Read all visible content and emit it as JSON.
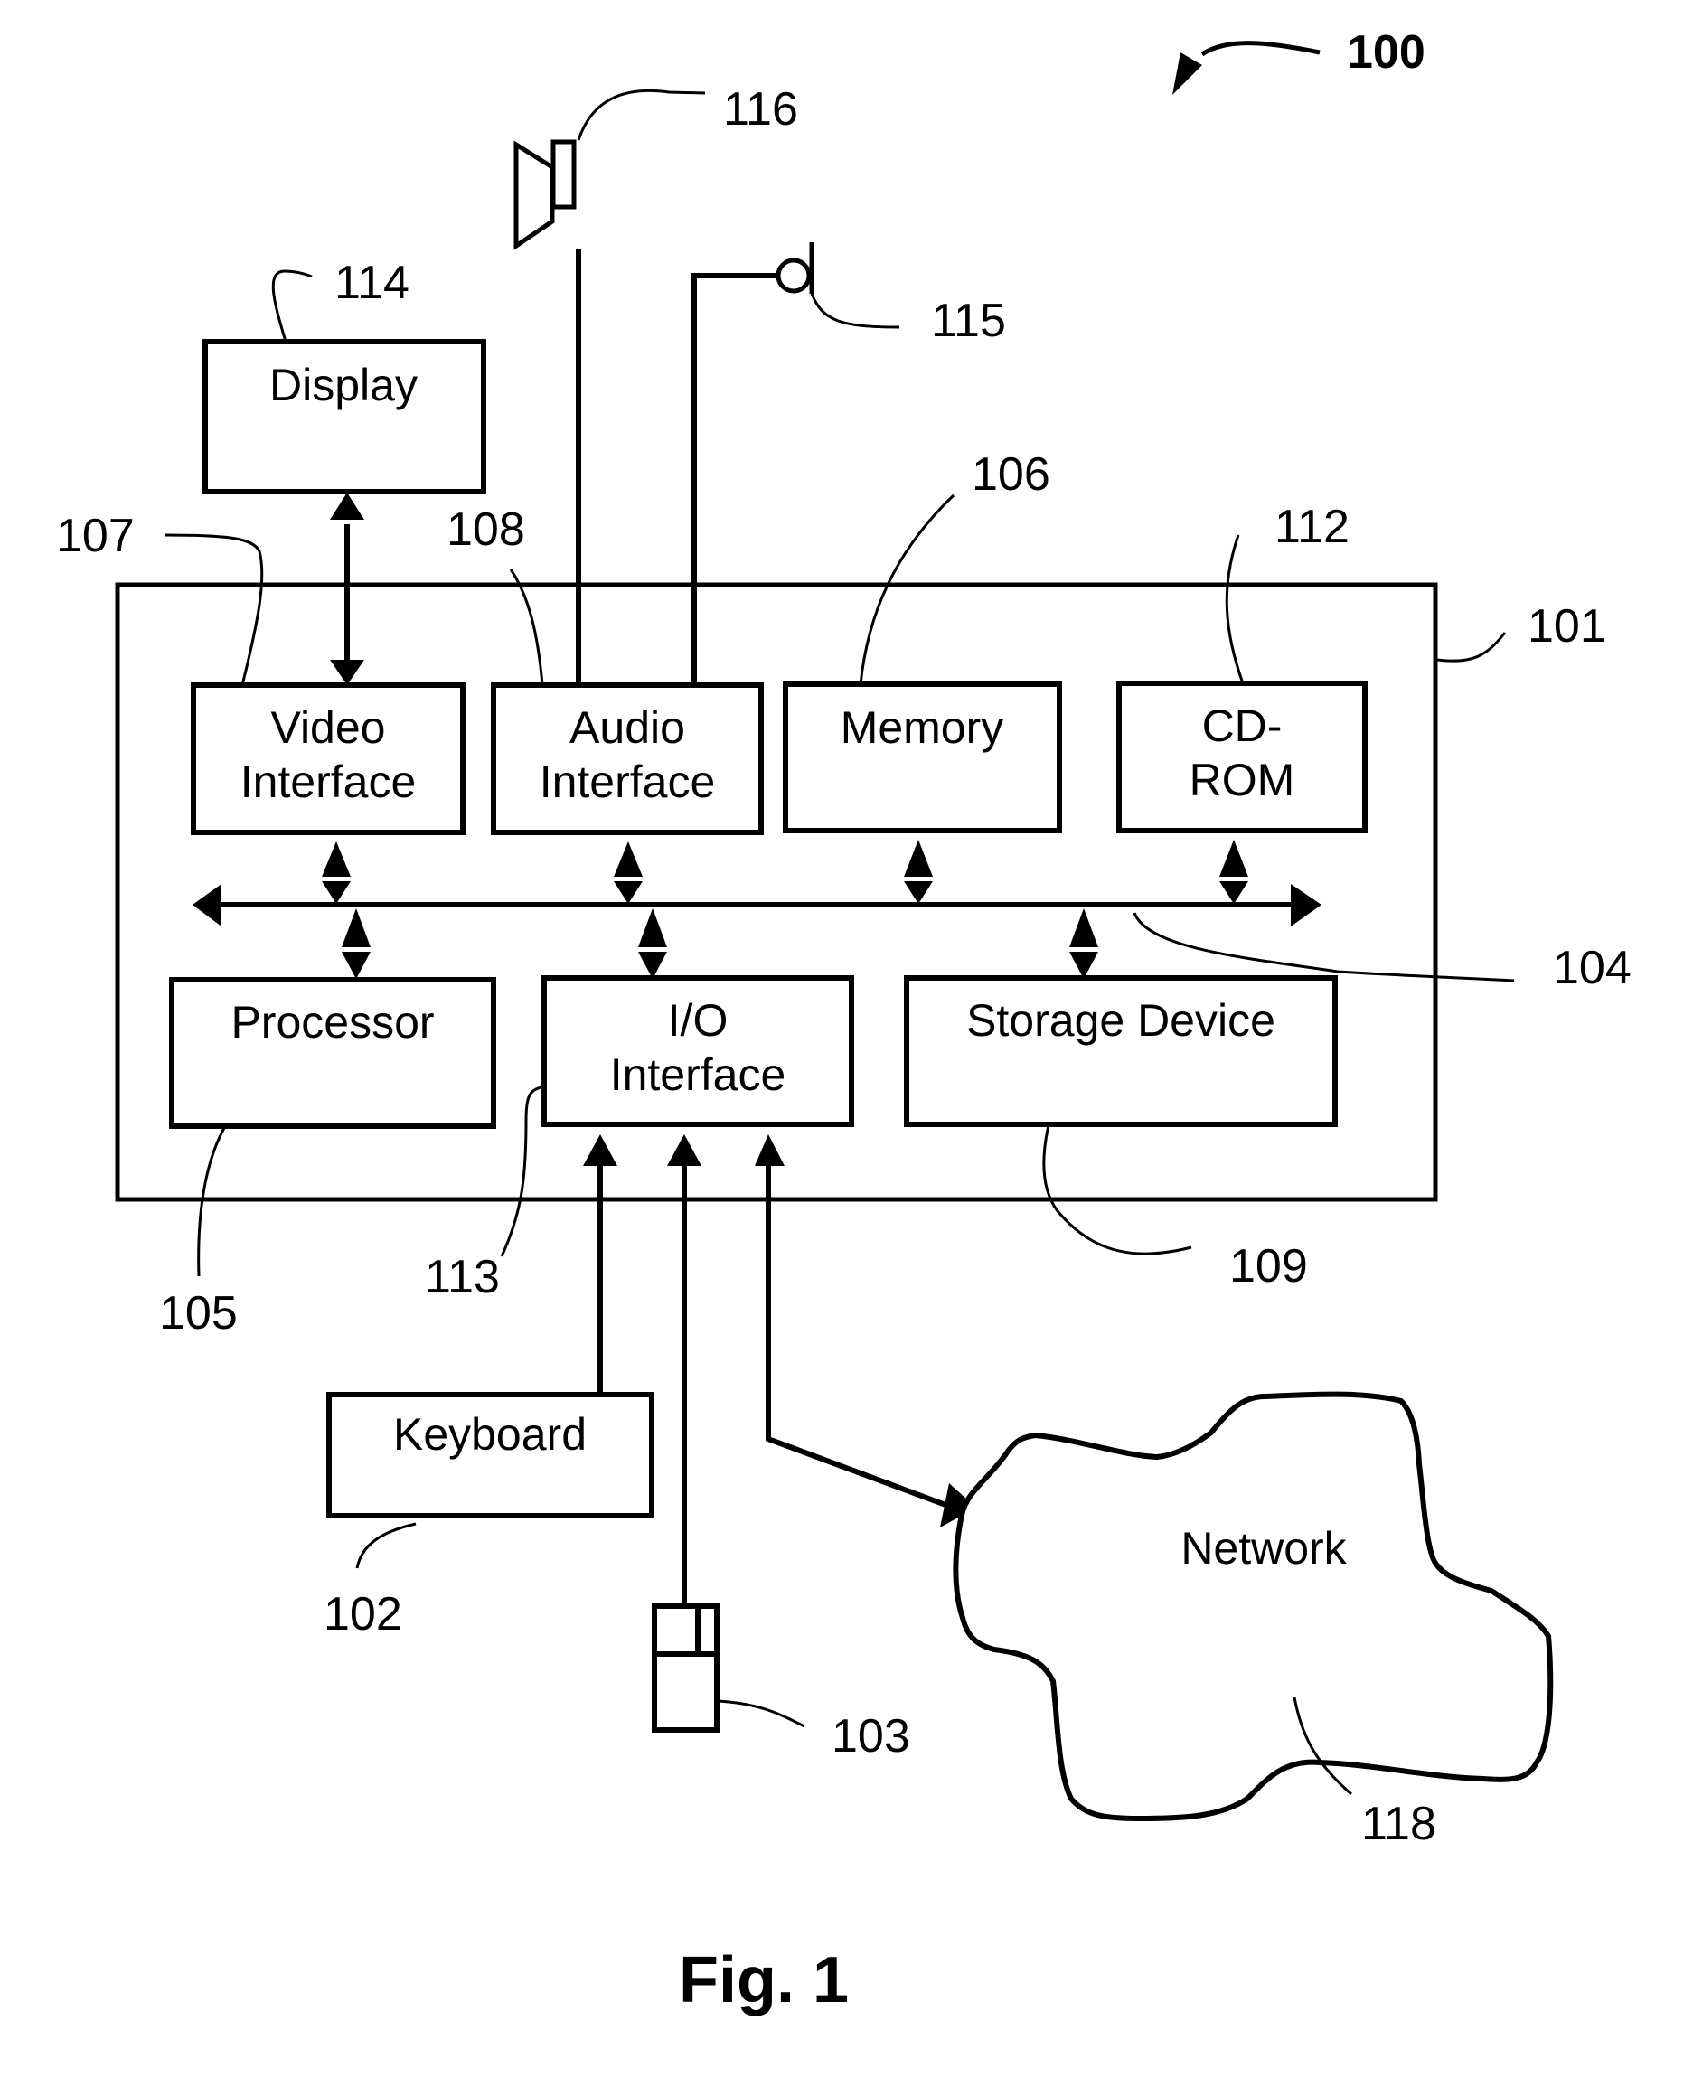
{
  "figure": {
    "caption": "Fig. 1",
    "system_ref": "100"
  },
  "computer": {
    "ref": "101",
    "bus_ref": "104"
  },
  "components": {
    "video_interface": {
      "line1": "Video",
      "line2": "Interface",
      "ref": "107"
    },
    "audio_interface": {
      "line1": "Audio",
      "line2": "Interface",
      "ref": "108"
    },
    "memory": {
      "line1": "Memory",
      "ref": "106"
    },
    "cdrom": {
      "line1": "CD-",
      "line2": "ROM",
      "ref": "112"
    },
    "processor": {
      "line1": "Processor",
      "ref": "105"
    },
    "io_interface": {
      "line1": "I/O",
      "line2": "Interface",
      "ref": "113"
    },
    "storage_device": {
      "line1": "Storage Device",
      "ref": "109"
    }
  },
  "peripherals": {
    "display": {
      "label": "Display",
      "ref": "114"
    },
    "speaker": {
      "ref": "116"
    },
    "microphone": {
      "ref": "115"
    },
    "keyboard": {
      "label": "Keyboard",
      "ref": "102"
    },
    "mouse": {
      "ref": "103"
    },
    "network": {
      "label": "Network",
      "ref": "118"
    }
  }
}
